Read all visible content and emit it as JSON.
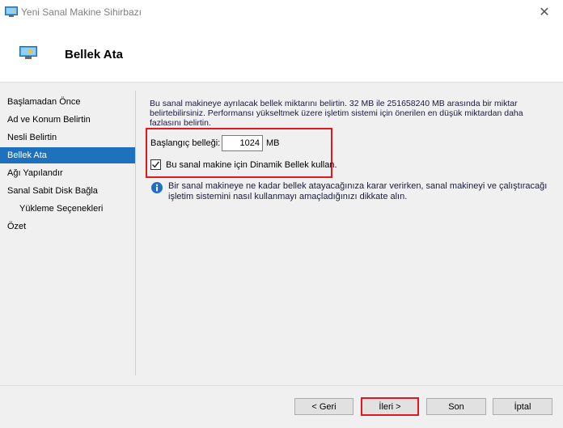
{
  "window": {
    "title": "Yeni Sanal Makine Sihirbazı",
    "close_glyph": "✕"
  },
  "header": {
    "title": "Bellek Ata"
  },
  "nav": {
    "items": [
      {
        "label": "Başlamadan Önce",
        "active": false
      },
      {
        "label": "Ad ve Konum Belirtin",
        "active": false
      },
      {
        "label": "Nesli Belirtin",
        "active": false
      },
      {
        "label": "Bellek Ata",
        "active": true
      },
      {
        "label": "Ağı Yapılandır",
        "active": false
      },
      {
        "label": "Sanal Sabit Disk Bağla",
        "active": false
      },
      {
        "label": "Yükleme Seçenekleri",
        "active": false
      },
      {
        "label": "Özet",
        "active": false
      }
    ]
  },
  "content": {
    "description": "Bu sanal makineye ayrılacak bellek miktarını belirtin. 32 MB ile 251658240 MB arasında bir miktar belirtebilirsiniz. Performansı yükseltmek üzere işletim sistemi için önerilen en düşük miktardan daha fazlasını belirtin.",
    "startup_memory_label": "Başlangıç belleği:",
    "startup_memory_value": "1024",
    "memory_unit": "MB",
    "dynamic_memory_label": "Bu sanal makine için Dinamik Bellek kullan.",
    "dynamic_memory_checked": true,
    "info_text": "Bir sanal makineye ne kadar bellek atayacağınıza karar verirken, sanal makineyi ve çalıştıracağı işletim sistemini nasıl kullanmayı amaçladığınızı dikkate alın."
  },
  "buttons": {
    "back": "< Geri",
    "next": "İleri >",
    "finish": "Son",
    "cancel": "İptal"
  },
  "colors": {
    "accent": "#1e72bd",
    "highlight": "#e0191f"
  }
}
